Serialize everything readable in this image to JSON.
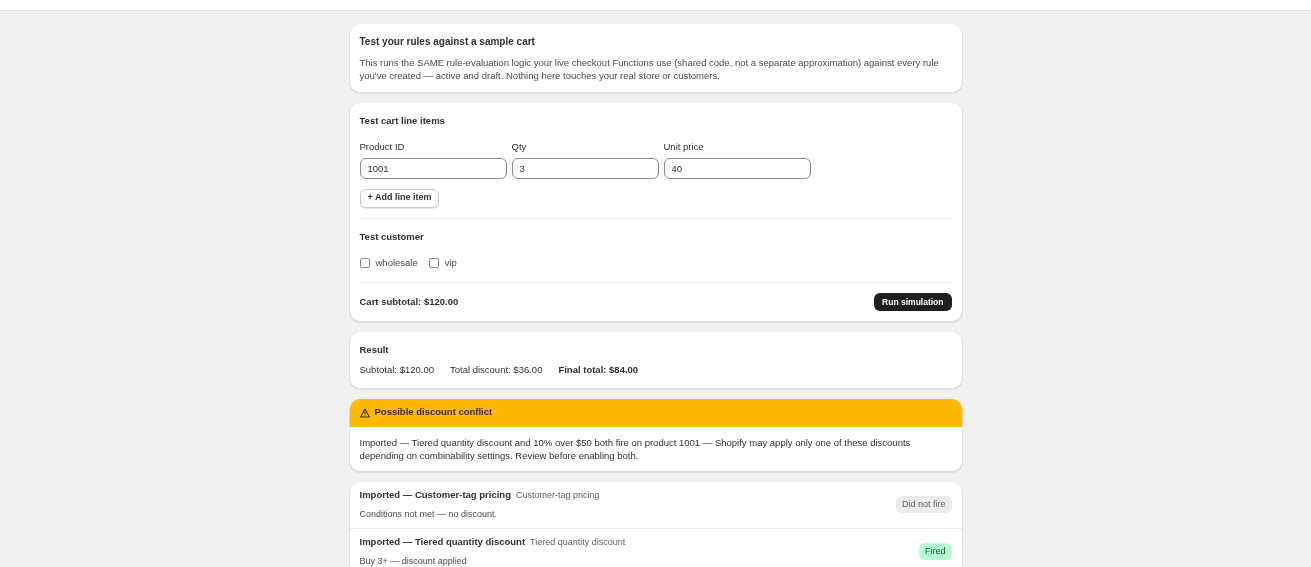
{
  "intro": {
    "title": "Test your rules against a sample cart",
    "description": "This runs the SAME rule-evaluation logic your live checkout Functions use (shared code, not a separate approximation) against every rule you've created — active and draft. Nothing here touches your real store or customers."
  },
  "line_items": {
    "title": "Test cart line items",
    "fields": [
      {
        "label": "Product ID",
        "value": "1001"
      },
      {
        "label": "Qty",
        "value": "3"
      },
      {
        "label": "Unit price",
        "value": "40"
      }
    ],
    "add_button": "+ Add line item"
  },
  "customer": {
    "title": "Test customer",
    "tags": [
      {
        "label": "wholesale",
        "checked": false
      },
      {
        "label": "vip",
        "checked": false
      }
    ]
  },
  "cart_subtotal": "Cart subtotal: $120.00",
  "run_button": "Run simulation",
  "result": {
    "title": "Result",
    "subtotal": "Subtotal: $120.00",
    "discount": "Total discount: $36.00",
    "final": "Final total: $84.00"
  },
  "warning": {
    "title": "Possible discount conflict",
    "message": "Imported — Tiered quantity discount and 10% over $50 both fire on product 1001 — Shopify may apply only one of these discounts depending on combinability settings. Review before enabling both."
  },
  "rules": [
    {
      "name": "Imported — Customer-tag pricing",
      "type": "Customer-tag pricing",
      "detail": "Conditions not met — no discount.",
      "status": "Did not fire",
      "fired": false
    },
    {
      "name": "Imported — Tiered quantity discount",
      "type": "Tiered quantity discount",
      "detail": "Buy 3+ — discount applied",
      "status": "Fired",
      "fired": true
    }
  ]
}
